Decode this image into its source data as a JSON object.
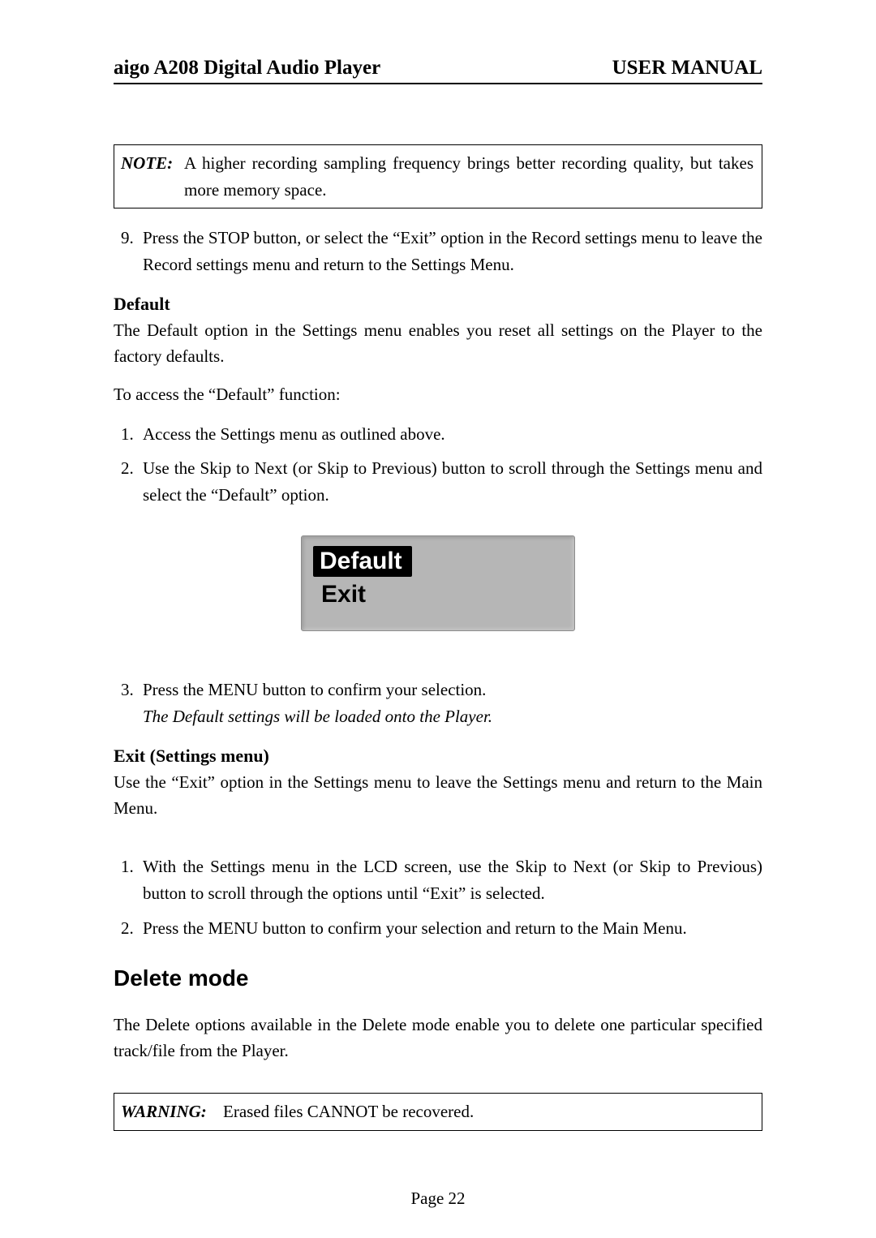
{
  "header": {
    "left": "aigo A208 Digital Audio Player",
    "right": "USER MANUAL"
  },
  "note": {
    "label": "NOTE:",
    "text": "A higher recording sampling frequency brings better recording quality, but takes more memory space."
  },
  "step9": {
    "number": "9.",
    "text": "Press the STOP button, or select the “Exit” option in the Record settings menu to leave the Record settings menu and return to the Settings Menu."
  },
  "default_section": {
    "heading": "Default",
    "intro": "The Default option in the Settings menu enables you reset all settings on the Player to the factory defaults.",
    "access_line": "To access the “Default” function:",
    "steps": [
      "Access the Settings menu as outlined above.",
      "Use the Skip to Next (or Skip to Previous) button to scroll through the Settings menu and select the “Default” option."
    ],
    "lcd": {
      "selected": "Default",
      "other": "Exit"
    },
    "step3_line1": "Press the MENU button to confirm your selection.",
    "step3_line2": "The Default settings will be loaded onto the Player."
  },
  "exit_section": {
    "heading": "Exit (Settings menu)",
    "intro": "Use the “Exit” option in the Settings menu to leave the Settings menu and return to the Main Menu.",
    "steps": [
      "With the Settings menu in the LCD screen, use the Skip to Next (or Skip to Previous) button to scroll through the options until “Exit” is selected.",
      "Press the MENU button to confirm your selection and return to the Main Menu."
    ]
  },
  "delete_section": {
    "heading": "Delete mode",
    "intro": "The Delete options available in the Delete mode enable you to delete one particular specified track/file from the Player."
  },
  "warning": {
    "label": "WARNING:",
    "text": "Erased files CANNOT be recovered."
  },
  "page_number": "Page 22"
}
